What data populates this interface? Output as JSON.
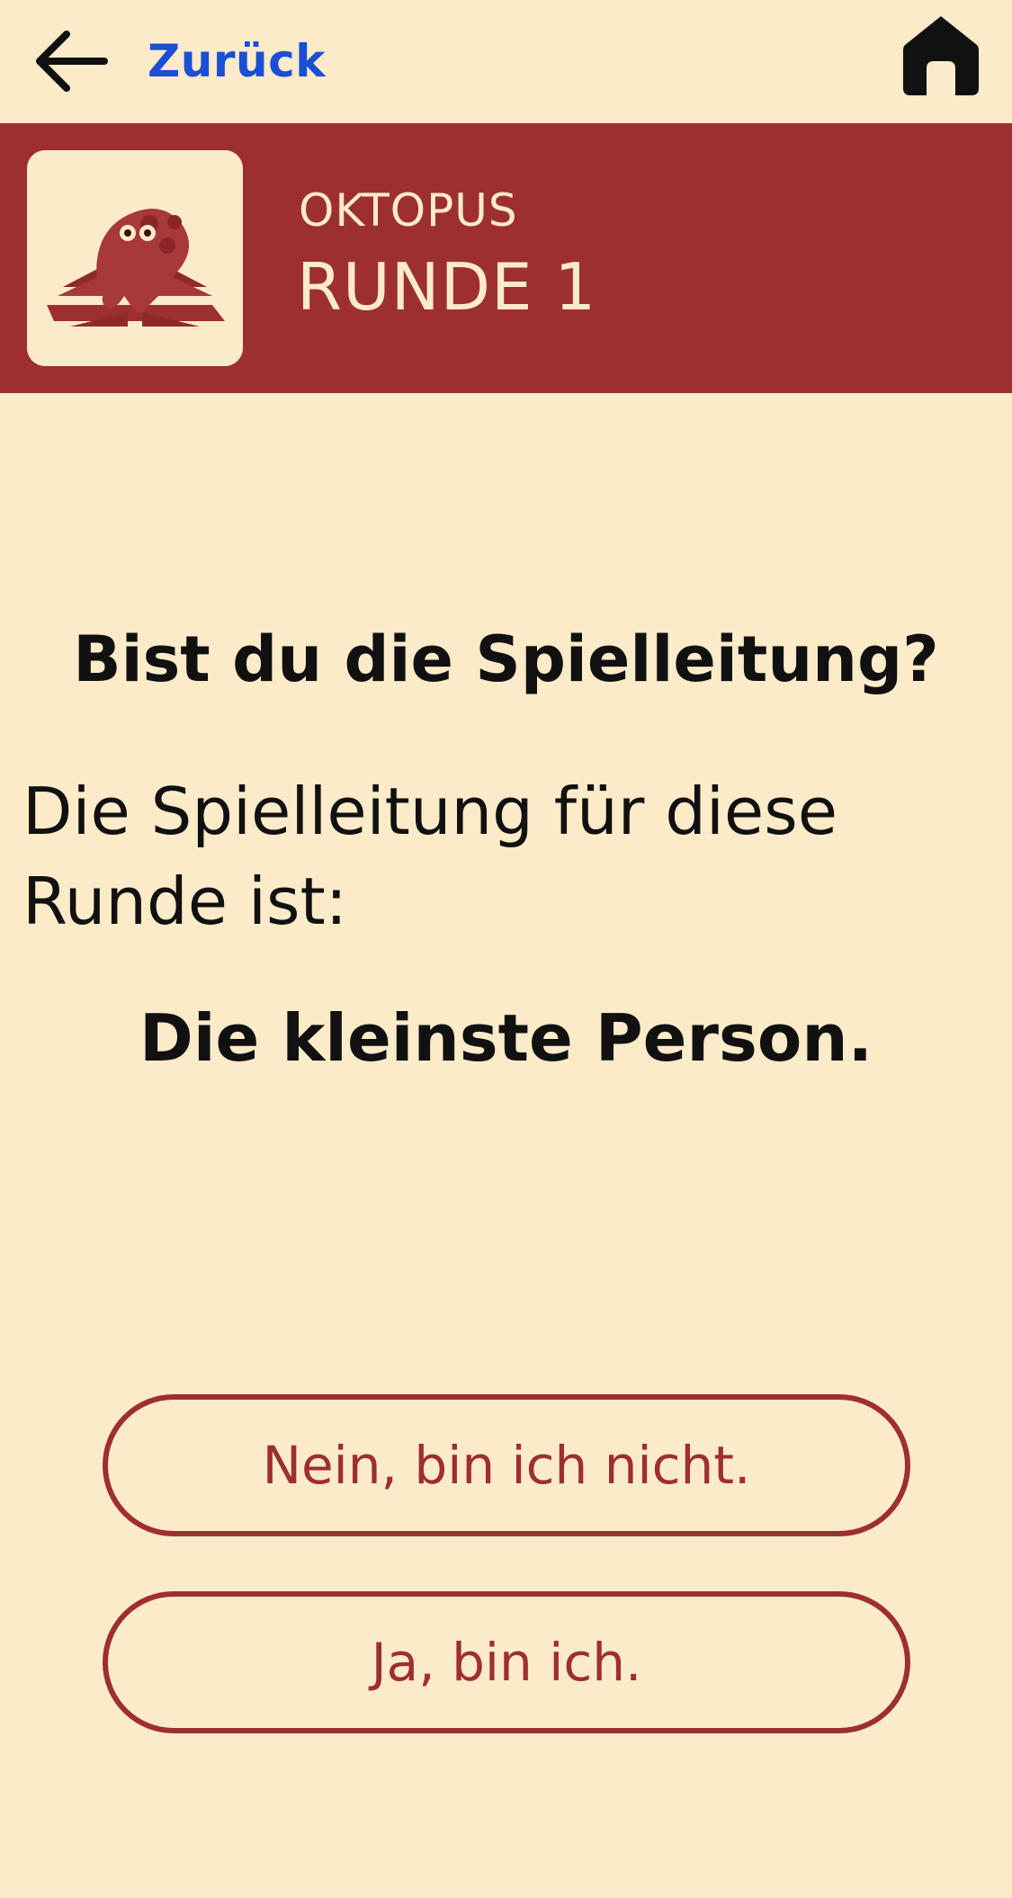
{
  "nav": {
    "back_label": "Zurück",
    "back_icon": "arrow-left-icon",
    "home_icon": "home-icon"
  },
  "header": {
    "game_name": "OKTOPUS",
    "round_title": "RUNDE 1",
    "game_icon": "octopus-icon"
  },
  "content": {
    "question": "Bist du die Spielleitung?",
    "intro": "Die Spielleitung für diese Runde ist:",
    "leader": "Die kleinste Person."
  },
  "actions": {
    "no_label": "Nein, bin ich nicht.",
    "yes_label": "Ja, bin ich."
  },
  "colors": {
    "background": "#fcebc9",
    "accent": "#9e2f31",
    "link": "#1a4fd6"
  }
}
